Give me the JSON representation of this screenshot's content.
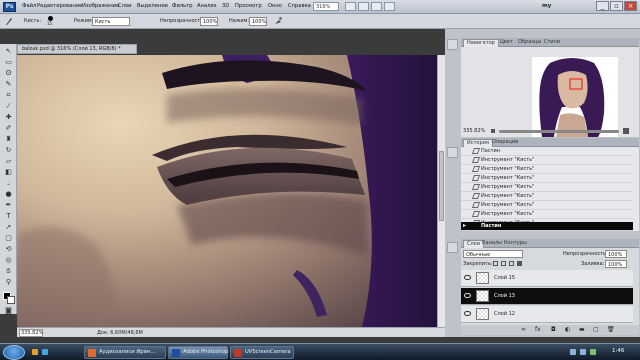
{
  "app": {
    "logo": "Ps"
  },
  "menu": [
    "Файл",
    "Редактирование",
    "Изображение",
    "Слои",
    "Выделение",
    "Фильтр",
    "Анализ",
    "3D",
    "Просмотр",
    "Окно",
    "Справка"
  ],
  "menubar": {
    "zoom": "316%",
    "workspace": "my"
  },
  "options": {
    "brush_label": "Кисть:",
    "brush_size": "15",
    "mode_label": "Режим:",
    "mode_value": "Кисть",
    "opacity_label": "Непрозрачность:",
    "opacity_value": "100%",
    "flow_label": "Нажим:",
    "flow_value": "100%"
  },
  "document": {
    "tab": "balzak.psd @ 316% (Слой 13, RGB/8) *",
    "zoom": "335.82%",
    "size": "Док: 6,60M/48,6M"
  },
  "navigator": {
    "tabs": [
      "Навигатор",
      "Цвет",
      "Образцы",
      "Стили"
    ],
    "zoom": "335.82%"
  },
  "history": {
    "tabs": [
      "История",
      "Операции"
    ],
    "items": [
      "Пастин",
      "Инструмент \"Кисть\"",
      "Инструмент \"Кисть\"",
      "Инструмент \"Кисть\"",
      "Инструмент \"Кисть\"",
      "Инструмент \"Кисть\"",
      "Инструмент \"Кисть\"",
      "Инструмент \"Кисть\"",
      "Инструмент \"Кисть\"",
      "Пастин"
    ],
    "selected_index": 9
  },
  "layers": {
    "tabs": [
      "Слои",
      "Каналы",
      "Контуры"
    ],
    "blend_mode": "Обычные",
    "opacity_label": "Непрозрачность:",
    "opacity_value": "100%",
    "lock_label": "Закрепить:",
    "fill_label": "Заливка:",
    "fill_value": "100%",
    "items": [
      "Слой 15",
      "Слой 13",
      "Слой 12"
    ],
    "selected_index": 1
  },
  "taskbar": {
    "items": [
      "Аудиозаписи Ирин...",
      "Adobe Photoshop ...",
      "UVScreenCamera"
    ],
    "active_index": 1,
    "clock": "1:46"
  },
  "colors": {
    "foreground": "#000000",
    "background": "#ffffff",
    "accent": "#1f4f9c"
  }
}
